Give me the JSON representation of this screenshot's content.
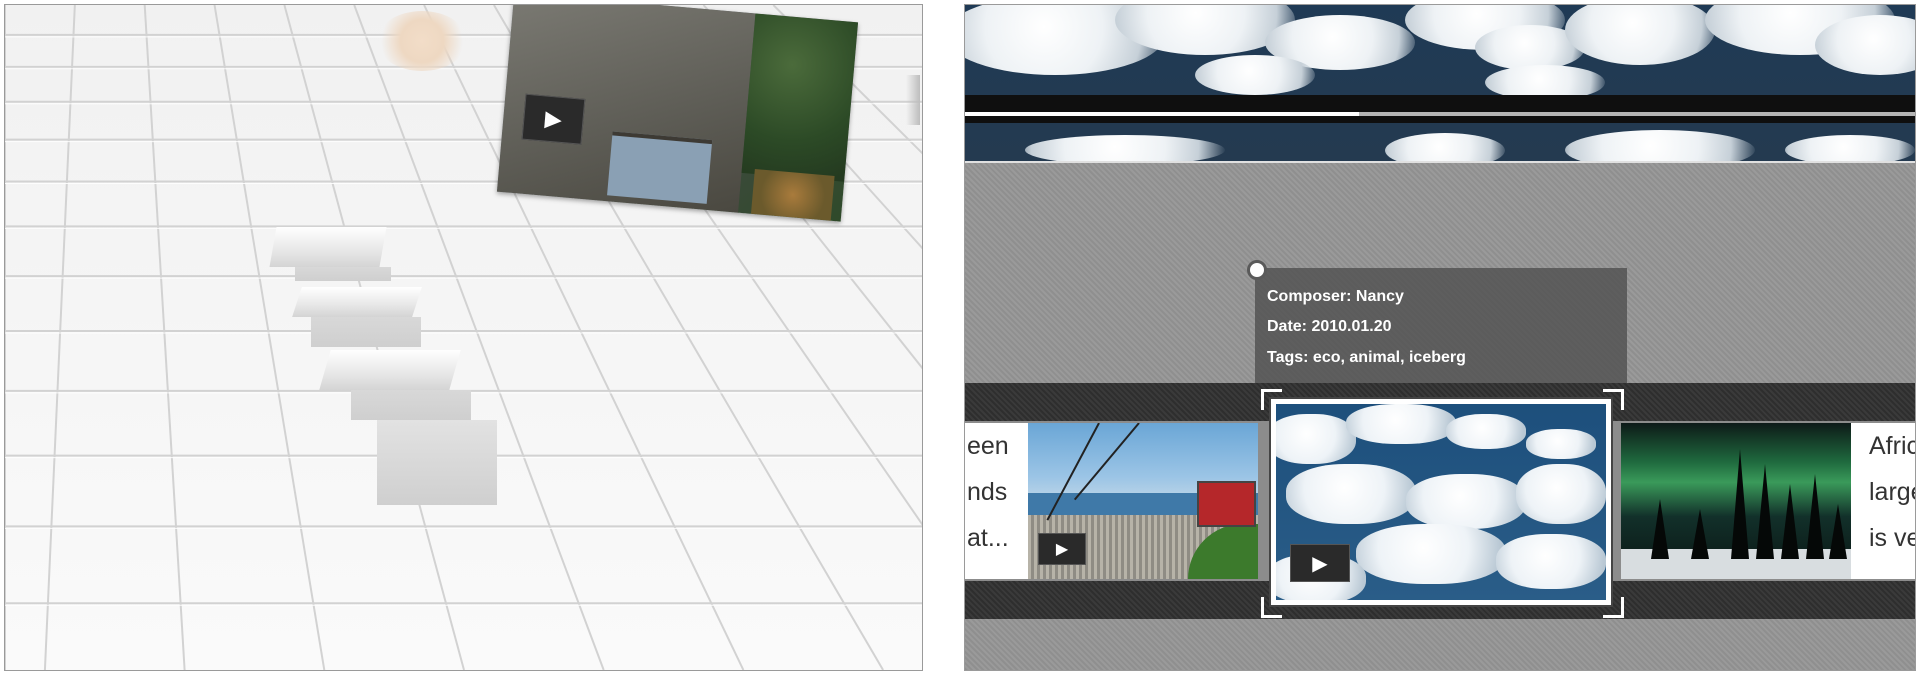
{
  "left_scene": {
    "play_icon": "▶"
  },
  "right_player": {
    "progress": 0.415,
    "tooltip": {
      "composer": "Composer: Nancy",
      "date": "Date: 2010.01.20",
      "tags": "Tags: eco, animal, iceberg"
    },
    "left_card_lines": [
      "een",
      "nds",
      "at..."
    ],
    "right_card_lines": [
      "Afric",
      "large",
      "is ve"
    ],
    "play_icon": "▶"
  },
  "colors": {
    "accent_white": "#ffffff",
    "tooltip_bg": "#505050",
    "strip_dark": "#2e2e2e"
  }
}
